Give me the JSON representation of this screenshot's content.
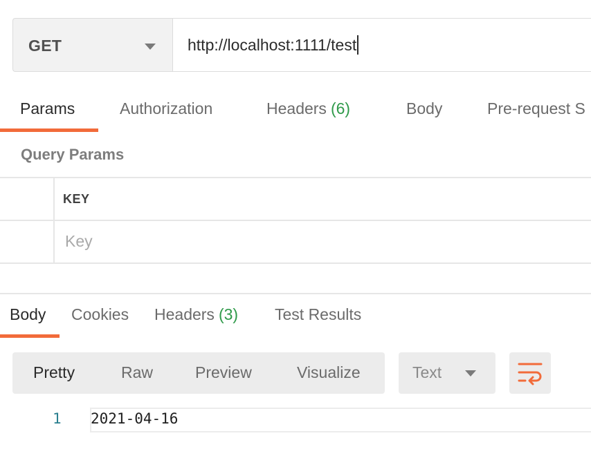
{
  "request": {
    "method": "GET",
    "url": "http://localhost:1111/test"
  },
  "request_tabs": {
    "params": "Params",
    "authorization": "Authorization",
    "headers": "Headers",
    "headers_count": "(6)",
    "body": "Body",
    "pre_request": "Pre-request S"
  },
  "params": {
    "section_title": "Query Params",
    "column_key": "KEY",
    "key_placeholder": "Key"
  },
  "response_tabs": {
    "body": "Body",
    "cookies": "Cookies",
    "headers": "Headers",
    "headers_count": "(3)",
    "test_results": "Test Results"
  },
  "response_view": {
    "pretty": "Pretty",
    "raw": "Raw",
    "preview": "Preview",
    "visualize": "Visualize",
    "format": "Text",
    "wrap_icon": "wrap-lines-icon"
  },
  "response_body": {
    "line_number": "1",
    "content": "2021-04-16"
  },
  "colors": {
    "accent": "#f26b3a",
    "count_green": "#2f9a4a",
    "line_number": "#2a7f8f"
  }
}
